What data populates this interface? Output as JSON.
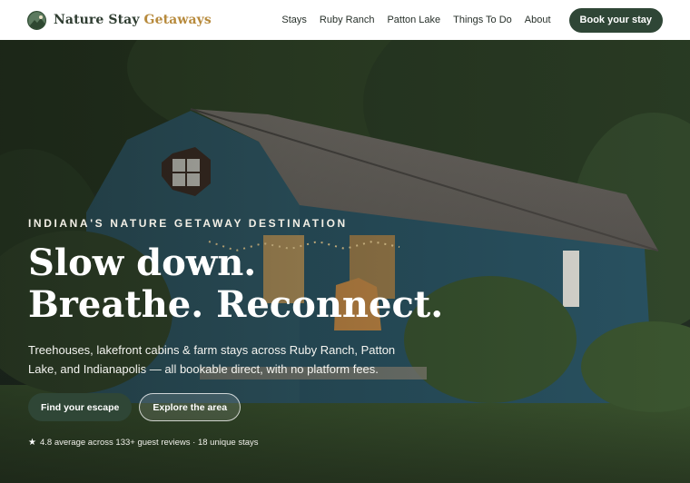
{
  "header": {
    "brand": {
      "name_part1": "Nature Stay",
      "name_part2": "Getaways",
      "logo_icon": "landscape-logo-icon"
    },
    "nav": [
      {
        "label": "Stays"
      },
      {
        "label": "Ruby Ranch"
      },
      {
        "label": "Patton Lake"
      },
      {
        "label": "Things To Do"
      },
      {
        "label": "About"
      }
    ],
    "cta_label": "Book your stay"
  },
  "hero": {
    "eyebrow": "INDIANA'S NATURE GETAWAY DESTINATION",
    "headline_line1": "Slow down.",
    "headline_line2": "Breathe. Reconnect.",
    "subhead": "Treehouses, lakefront cabins & farm stays across Ruby Ranch, Patton Lake, and Indianapolis — all bookable direct, with no platform fees.",
    "primary_button": "Find your escape",
    "secondary_button": "Explore the area",
    "rating_icon": "star-icon",
    "rating_text": "4.8 average across 133+ guest reviews · 18 unique stays"
  },
  "colors": {
    "brand_dark": "#2f4636",
    "brand_gold": "#b78a3c",
    "text_dark": "#27302a"
  }
}
